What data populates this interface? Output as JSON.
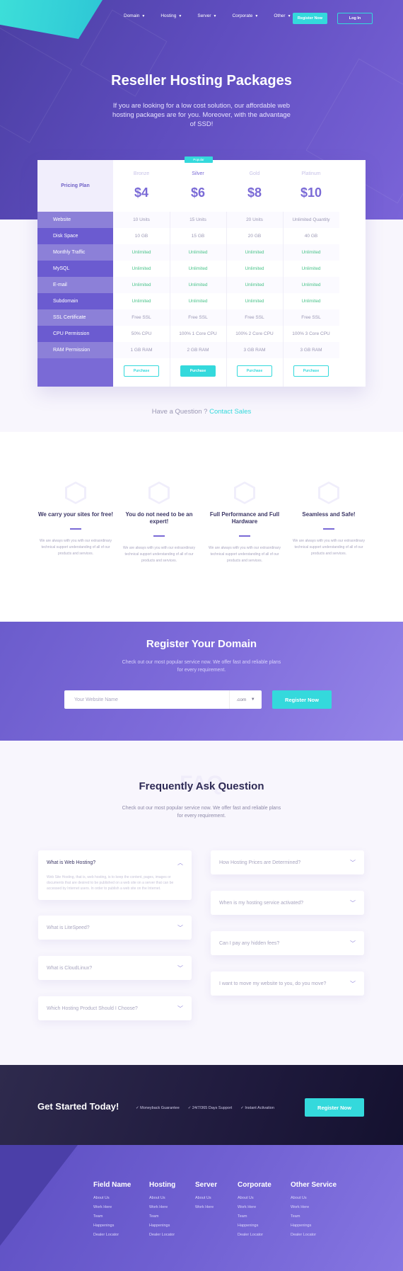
{
  "nav": {
    "items": [
      {
        "label": "Domain",
        "caret": "▼"
      },
      {
        "label": "Hosting",
        "caret": "▼"
      },
      {
        "label": "Server",
        "caret": "▼"
      },
      {
        "label": "Corporate",
        "caret": "▼"
      },
      {
        "label": "Other",
        "caret": "▼"
      }
    ],
    "register_label": "Register Now",
    "login_label": "Log In"
  },
  "hero": {
    "title": "Reseller Hosting Packages",
    "subtitle": "If you are looking for a low cost solution, our affordable web hosting packages are for you. Moreover, with the advantage of SSD!"
  },
  "pricing": {
    "header_label": "Pricing Plan",
    "popular_label": "Popular",
    "features": [
      "Website",
      "Disk Space",
      "Monthly Traffic",
      "MySQL",
      "E-mail",
      "Subdomain",
      "SSL Certificate",
      "CPU Permission",
      "RAM Permission"
    ],
    "plans": [
      {
        "name": "Bronze",
        "price": "$4",
        "values": [
          "10 Units",
          "10 GB",
          "Unlimited",
          "Unlimited",
          "Unlimited",
          "Unlimited",
          "Free SSL",
          "50%  CPU",
          "1 GB RAM"
        ],
        "button": "Purchase"
      },
      {
        "name": "Silver",
        "price": "$6",
        "values": [
          "15 Units",
          "15 GB",
          "Unlimited",
          "Unlimited",
          "Unlimited",
          "Unlimited",
          "Free SSL",
          "100% 1 Core CPU",
          "2 GB RAM"
        ],
        "button": "Purchase"
      },
      {
        "name": "Gold",
        "price": "$8",
        "values": [
          "20 Units",
          "20 GB",
          "Unlimited",
          "Unlimited",
          "Unlimited",
          "Unlimited",
          "Free SSL",
          "100% 2 Core CPU",
          "3 GB RAM"
        ],
        "button": "Purchase"
      },
      {
        "name": "Platinum",
        "price": "$10",
        "values": [
          "Unlimited Quantity",
          "40 GB",
          "Unlimited",
          "Unlimited",
          "Unlimited",
          "Unlimited",
          "Free SSL",
          "100% 3 Core CPU",
          "3 GB RAM"
        ],
        "button": "Purchase"
      }
    ],
    "question_prefix": "Have a Question ?",
    "question_link": "Contact Sales"
  },
  "features": [
    {
      "title": "We carry your sites for free!",
      "desc": "We are always with you with our extraordinary technical support understanding of all of our products and services."
    },
    {
      "title": "You do not need to be an expert!",
      "desc": "We are always with you with our extraordinary technical support understanding of all of our products and services."
    },
    {
      "title": "Full Performance and Full Hardware",
      "desc": "We are always with you with our extraordinary technical support understanding of all of our products and services."
    },
    {
      "title": "Seamless and Safe!",
      "desc": "We are always with you with our extraordinary technical support understanding of all of our products and services."
    }
  ],
  "domain": {
    "title": "Register Your Domain",
    "subtitle": "Check out our most popular service now. We offer fast and reliable plans for every requirement.",
    "input_placeholder": "Your Website  Name",
    "tld": ".com",
    "button": "Register Now"
  },
  "faq": {
    "ghost": "FAQ",
    "title": "Frequently Ask Question",
    "subtitle": "Check out our most popular service now. We offer fast and reliable plans for every requirement.",
    "left": [
      {
        "q": "What is Web Hosting?",
        "a": "Web Site Hosting, that is, web hosting, is to keep the content, pages, images or documents that are desired to be published on a web site on a server that can be accessed by Internet users. In order to publish a web site on the Internet."
      },
      {
        "q": "What is LiteSpeed?"
      },
      {
        "q": "What is CloudLinux?"
      },
      {
        "q": "Which Hosting Product Should I Choose?"
      }
    ],
    "right": [
      {
        "q": "How Hosting Prices are Determined?"
      },
      {
        "q": "When is my hosting service activated?"
      },
      {
        "q": "Can I pay any hidden fees?"
      },
      {
        "q": "I want to move my website to you, do you move?"
      }
    ]
  },
  "cta": {
    "title": "Get Started Today!",
    "checks": [
      "✓ Moneyback Guarantee",
      "✓ 24/7/365 Days Support",
      "✓ Instant Activation"
    ],
    "button": "Register Now"
  },
  "footer": {
    "columns": [
      {
        "title": "Field Name",
        "links": [
          "About Us",
          "Work Here",
          "Team",
          "Happenings",
          "Dealer Locator"
        ]
      },
      {
        "title": "Hosting",
        "links": [
          "About Us",
          "Work Here",
          "Team",
          "Happenings",
          "Dealer Locator"
        ]
      },
      {
        "title": "Server",
        "links": [
          "About Us",
          "Work Here"
        ]
      },
      {
        "title": "Corporate",
        "links": [
          "About Us",
          "Work Here",
          "Team",
          "Happenings",
          "Dealer Locator"
        ]
      },
      {
        "title": "Other Service",
        "links": [
          "About Us",
          "Work Here",
          "Team",
          "Happenings",
          "Dealer Locator"
        ]
      }
    ]
  },
  "colors": {
    "accent": "#34d9dc",
    "brand": "#7a6ad6",
    "dark": "#1f1a3d",
    "green": "#4ac38a"
  }
}
